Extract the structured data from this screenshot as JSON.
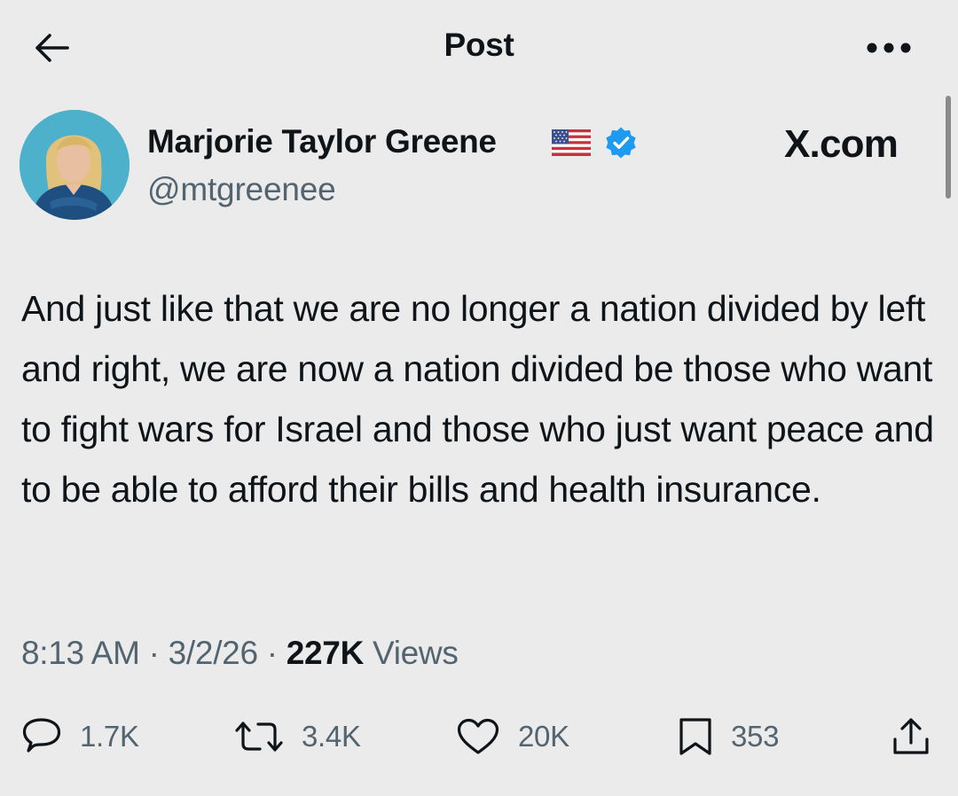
{
  "header": {
    "title": "Post",
    "back_icon": "arrow-left-icon",
    "more_icon": "more-horizontal-icon"
  },
  "author": {
    "name": "Marjorie Taylor Greene",
    "handle": "@mtgreenee",
    "flag_icon": "us-flag-icon",
    "verified_icon": "verified-badge-icon",
    "verified_color": "#1d9bf0"
  },
  "source_label": "X.com",
  "post": {
    "text": "And just like that we are no longer a nation divided by left and right, we are now a nation divided be those who want to fight wars for Israel and those who just want peace and to be able to afford their bills and health insurance."
  },
  "meta": {
    "time": "8:13 AM",
    "separator": "·",
    "date": "3/2/26",
    "views_count": "227K",
    "views_label": "Views"
  },
  "actions": {
    "replies": {
      "icon": "reply-icon",
      "count": "1.7K"
    },
    "reposts": {
      "icon": "repost-icon",
      "count": "3.4K"
    },
    "likes": {
      "icon": "heart-icon",
      "count": "20K"
    },
    "bookmarks": {
      "icon": "bookmark-icon",
      "count": "353"
    },
    "share": {
      "icon": "share-icon"
    }
  },
  "colors": {
    "background": "#ebebeb",
    "text": "#0f1419",
    "secondary_text": "#536471",
    "accent": "#1d9bf0"
  }
}
